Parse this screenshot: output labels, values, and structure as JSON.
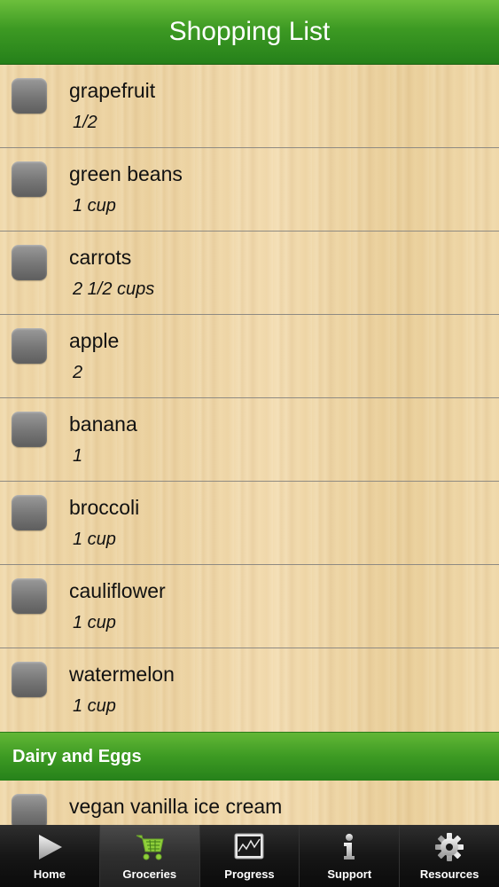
{
  "header": {
    "title": "Shopping List"
  },
  "items": [
    {
      "name": "grapefruit",
      "qty": "1/2"
    },
    {
      "name": "green beans",
      "qty": "1 cup"
    },
    {
      "name": "carrots",
      "qty": "2 1/2 cups"
    },
    {
      "name": "apple",
      "qty": "2"
    },
    {
      "name": "banana",
      "qty": "1"
    },
    {
      "name": "broccoli",
      "qty": "1 cup"
    },
    {
      "name": "cauliflower",
      "qty": "1 cup"
    },
    {
      "name": "watermelon",
      "qty": "1 cup"
    }
  ],
  "section": {
    "title": "Dairy and Eggs"
  },
  "section_items": [
    {
      "name": "vegan vanilla ice cream"
    }
  ],
  "tabs": [
    {
      "label": "Home",
      "icon": "play-icon"
    },
    {
      "label": "Groceries",
      "icon": "cart-icon",
      "active": true
    },
    {
      "label": "Progress",
      "icon": "chart-icon"
    },
    {
      "label": "Support",
      "icon": "info-icon"
    },
    {
      "label": "Resources",
      "icon": "gear-icon"
    }
  ],
  "colors": {
    "accent_green": "#3d9a23",
    "tabbar": "#111111"
  }
}
